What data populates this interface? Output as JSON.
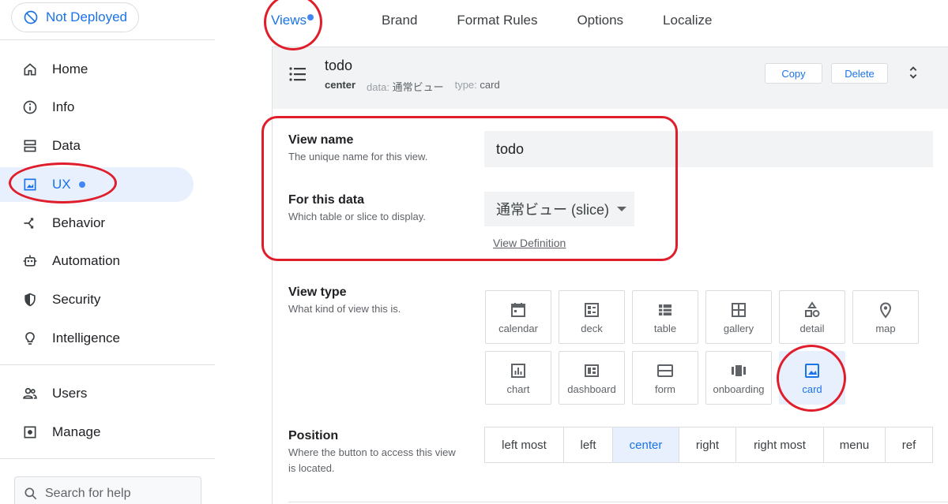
{
  "sidebar": {
    "deploy_label": "Not Deployed",
    "items": [
      {
        "label": "Home",
        "icon": "home-icon"
      },
      {
        "label": "Info",
        "icon": "info-icon"
      },
      {
        "label": "Data",
        "icon": "data-icon"
      },
      {
        "label": "UX",
        "icon": "ux-icon"
      },
      {
        "label": "Behavior",
        "icon": "behavior-icon"
      },
      {
        "label": "Automation",
        "icon": "automation-icon"
      },
      {
        "label": "Security",
        "icon": "shield-icon"
      },
      {
        "label": "Intelligence",
        "icon": "lightbulb-icon"
      },
      {
        "label": "Users",
        "icon": "users-icon"
      },
      {
        "label": "Manage",
        "icon": "manage-icon"
      }
    ],
    "active": "UX",
    "search_placeholder": "Search for help"
  },
  "tabs": [
    {
      "label": "Views",
      "active": true
    },
    {
      "label": "Brand"
    },
    {
      "label": "Format Rules"
    },
    {
      "label": "Options"
    },
    {
      "label": "Localize"
    }
  ],
  "view": {
    "title": "todo",
    "position": "center",
    "data_label": "data:",
    "data_value": "通常ビュー",
    "type_label": "type:",
    "type_value": "card",
    "copy_label": "Copy",
    "delete_label": "Delete"
  },
  "form": {
    "view_name_label": "View name",
    "view_name_desc": "The unique name for this view.",
    "view_name_value": "todo",
    "for_data_label": "For this data",
    "for_data_desc": "Which table or slice to display.",
    "for_data_value": "通常ビュー (slice)",
    "view_definition_link": "View Definition",
    "view_type_label": "View type",
    "view_type_desc": "What kind of view this is.",
    "view_types": [
      "calendar",
      "deck",
      "table",
      "gallery",
      "detail",
      "map",
      "chart",
      "dashboard",
      "form",
      "onboarding",
      "card"
    ],
    "selected_view_type": "card",
    "position_label": "Position",
    "position_desc": "Where the button to access this view is located.",
    "positions": [
      "left most",
      "left",
      "center",
      "right",
      "right most",
      "menu",
      "ref"
    ],
    "selected_position": "center"
  },
  "colors": {
    "accent": "#1a73e8",
    "selected_bg": "#e8f0fe",
    "annotation_red": "#e01e2b"
  }
}
